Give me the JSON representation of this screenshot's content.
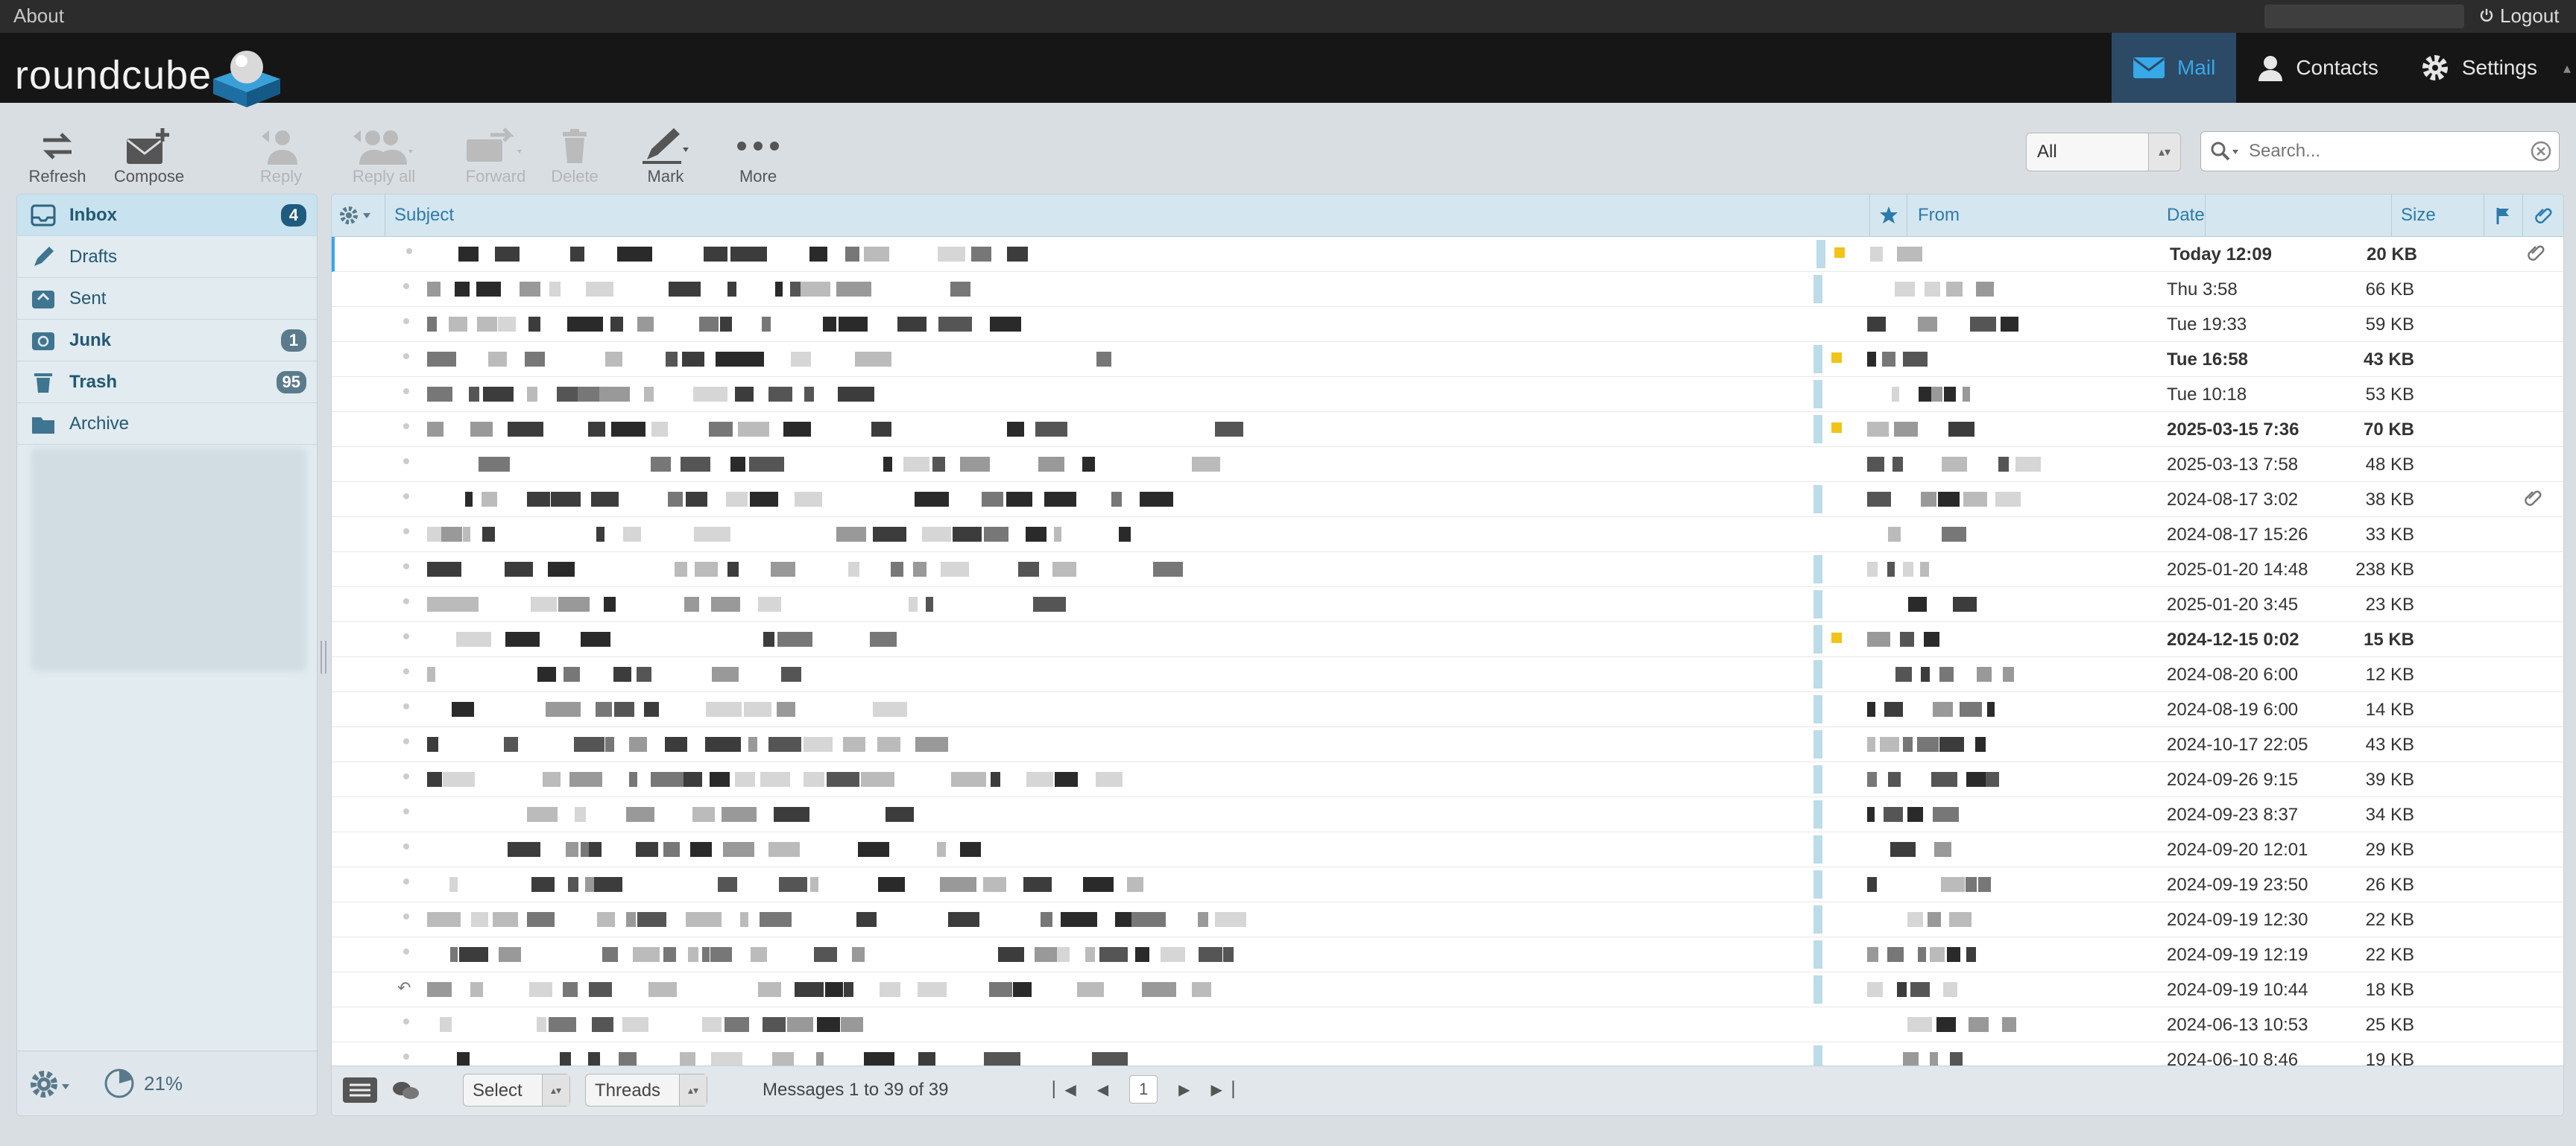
{
  "topbar": {
    "about": "About",
    "logout": "Logout"
  },
  "app": {
    "name": "roundcube"
  },
  "tasks": [
    {
      "label": "Mail",
      "icon": "mail-icon",
      "active": true
    },
    {
      "label": "Contacts",
      "icon": "contacts-icon",
      "active": false
    },
    {
      "label": "Settings",
      "icon": "gear-icon",
      "active": false
    }
  ],
  "toolbar": {
    "refresh": "Refresh",
    "compose": "Compose",
    "reply": "Reply",
    "reply_all": "Reply all",
    "forward": "Forward",
    "delete": "Delete",
    "mark": "Mark",
    "more": "More"
  },
  "filter": {
    "value": "All"
  },
  "search": {
    "placeholder": "Search..."
  },
  "folders": [
    {
      "label": "Inbox",
      "icon": "inbox-icon",
      "count": "4",
      "active": true,
      "bold": true
    },
    {
      "label": "Drafts",
      "icon": "drafts-icon",
      "count": "",
      "active": false,
      "bold": false
    },
    {
      "label": "Sent",
      "icon": "sent-icon",
      "count": "",
      "active": false,
      "bold": false
    },
    {
      "label": "Junk",
      "icon": "junk-icon",
      "count": "1",
      "active": false,
      "bold": true
    },
    {
      "label": "Trash",
      "icon": "trash-icon",
      "count": "95",
      "active": false,
      "bold": true
    },
    {
      "label": "Archive",
      "icon": "archive-icon",
      "count": "",
      "active": false,
      "bold": false
    }
  ],
  "quota": "21%",
  "list_header": {
    "subject": "Subject",
    "from": "From",
    "date": "Date",
    "size": "Size"
  },
  "messages": [
    {
      "date": "Today 12:09",
      "size": "20 KB",
      "unread": true,
      "attachment": true,
      "flagged_star": true,
      "replied": false
    },
    {
      "date": "Thu 3:58",
      "size": "66 KB",
      "unread": false,
      "attachment": false,
      "flagged_star": false,
      "replied": false
    },
    {
      "date": "Tue 19:33",
      "size": "59 KB",
      "unread": false,
      "attachment": false,
      "flagged_star": false,
      "replied": false
    },
    {
      "date": "Tue 16:58",
      "size": "43 KB",
      "unread": true,
      "attachment": false,
      "flagged_star": true,
      "replied": false
    },
    {
      "date": "Tue 10:18",
      "size": "53 KB",
      "unread": false,
      "attachment": false,
      "flagged_star": false,
      "replied": false
    },
    {
      "date": "2025-03-15 7:36",
      "size": "70 KB",
      "unread": true,
      "attachment": false,
      "flagged_star": true,
      "replied": false
    },
    {
      "date": "2025-03-13 7:58",
      "size": "48 KB",
      "unread": false,
      "attachment": false,
      "flagged_star": false,
      "replied": false
    },
    {
      "date": "2024-08-17 3:02",
      "size": "38 KB",
      "unread": false,
      "attachment": true,
      "flagged_star": false,
      "replied": false
    },
    {
      "date": "2024-08-17 15:26",
      "size": "33 KB",
      "unread": false,
      "attachment": false,
      "flagged_star": false,
      "replied": false
    },
    {
      "date": "2025-01-20 14:48",
      "size": "238 KB",
      "unread": false,
      "attachment": false,
      "flagged_star": false,
      "replied": false
    },
    {
      "date": "2025-01-20 3:45",
      "size": "23 KB",
      "unread": false,
      "attachment": false,
      "flagged_star": false,
      "replied": false
    },
    {
      "date": "2024-12-15 0:02",
      "size": "15 KB",
      "unread": true,
      "attachment": false,
      "flagged_star": true,
      "replied": false
    },
    {
      "date": "2024-08-20 6:00",
      "size": "12 KB",
      "unread": false,
      "attachment": false,
      "flagged_star": false,
      "replied": false
    },
    {
      "date": "2024-08-19 6:00",
      "size": "14 KB",
      "unread": false,
      "attachment": false,
      "flagged_star": false,
      "replied": false
    },
    {
      "date": "2024-10-17 22:05",
      "size": "43 KB",
      "unread": false,
      "attachment": false,
      "flagged_star": false,
      "replied": false
    },
    {
      "date": "2024-09-26 9:15",
      "size": "39 KB",
      "unread": false,
      "attachment": false,
      "flagged_star": false,
      "replied": false
    },
    {
      "date": "2024-09-23 8:37",
      "size": "34 KB",
      "unread": false,
      "attachment": false,
      "flagged_star": false,
      "replied": false
    },
    {
      "date": "2024-09-20 12:01",
      "size": "29 KB",
      "unread": false,
      "attachment": false,
      "flagged_star": false,
      "replied": false
    },
    {
      "date": "2024-09-19 23:50",
      "size": "26 KB",
      "unread": false,
      "attachment": false,
      "flagged_star": false,
      "replied": false
    },
    {
      "date": "2024-09-19 12:30",
      "size": "22 KB",
      "unread": false,
      "attachment": false,
      "flagged_star": false,
      "replied": false
    },
    {
      "date": "2024-09-19 12:19",
      "size": "22 KB",
      "unread": false,
      "attachment": false,
      "flagged_star": false,
      "replied": false
    },
    {
      "date": "2024-09-19 10:44",
      "size": "18 KB",
      "unread": false,
      "attachment": false,
      "flagged_star": false,
      "replied": true
    },
    {
      "date": "2024-06-13 10:53",
      "size": "25 KB",
      "unread": false,
      "attachment": false,
      "flagged_star": false,
      "replied": false
    },
    {
      "date": "2024-06-10 8:46",
      "size": "19 KB",
      "unread": false,
      "attachment": false,
      "flagged_star": false,
      "replied": false
    }
  ],
  "footer": {
    "select": "Select",
    "threads": "Threads",
    "count": "Messages 1 to 39 of 39",
    "page": "1"
  },
  "colors": {
    "accent": "#37a8e8",
    "header_bg": "#161616",
    "folder_active": "#c8e2ef",
    "star": "#f0c419"
  }
}
